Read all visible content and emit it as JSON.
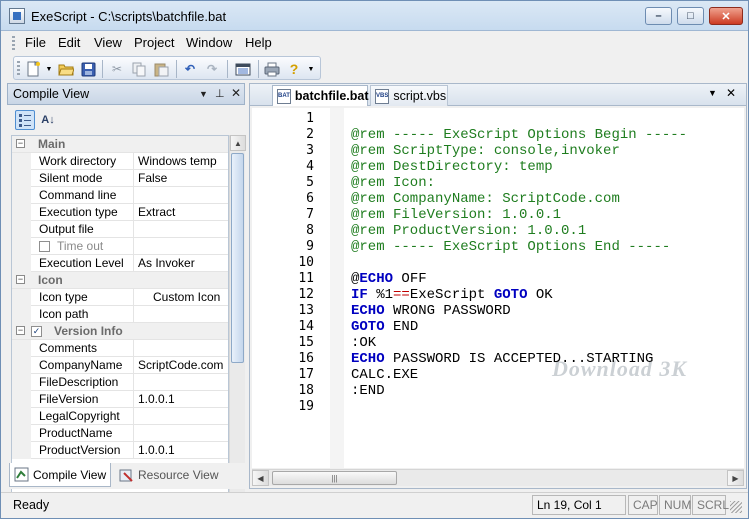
{
  "window": {
    "title": "ExeScript - C:\\scripts\\batchfile.bat",
    "minimize": "–",
    "maximize": "□",
    "close": "✕"
  },
  "menu": [
    "File",
    "Edit",
    "View",
    "Project",
    "Window",
    "Help"
  ],
  "toolbar": {
    "icons": [
      "new-file-icon",
      "open-folder-icon",
      "save-icon",
      "cut-icon",
      "copy-icon",
      "paste-icon",
      "undo-icon",
      "redo-icon",
      "compile-icon",
      "print-icon",
      "help-icon"
    ]
  },
  "left_panel": {
    "title": "Compile View",
    "rows": [
      {
        "type": "category",
        "label": "Main",
        "expanded": "⊟"
      },
      {
        "type": "prop",
        "key": "Work directory",
        "value": "Windows temp"
      },
      {
        "type": "prop",
        "key": "Silent mode",
        "value": "False"
      },
      {
        "type": "prop",
        "key": "Command line",
        "value": ""
      },
      {
        "type": "prop",
        "key": "Execution type",
        "value": "Extract"
      },
      {
        "type": "prop",
        "key": "Output file",
        "value": ""
      },
      {
        "type": "propcheck",
        "key": "Time out",
        "value": ""
      },
      {
        "type": "prop",
        "key": "Execution Level",
        "value": "As Invoker"
      },
      {
        "type": "category",
        "label": "Icon",
        "expanded": "⊟"
      },
      {
        "type": "prop",
        "key": "Icon type",
        "value": "Custom Icon"
      },
      {
        "type": "prop",
        "key": "Icon path",
        "value": ""
      },
      {
        "type": "categorycheck",
        "label": "Version Info",
        "expanded": "⊟"
      },
      {
        "type": "prop",
        "key": "Comments",
        "value": ""
      },
      {
        "type": "prop",
        "key": "CompanyName",
        "value": "ScriptCode.com"
      },
      {
        "type": "prop",
        "key": "FileDescription",
        "value": ""
      },
      {
        "type": "prop",
        "key": "FileVersion",
        "value": "1.0.0.1"
      },
      {
        "type": "prop",
        "key": "LegalCopyright",
        "value": ""
      },
      {
        "type": "prop",
        "key": "ProductName",
        "value": ""
      },
      {
        "type": "prop",
        "key": "ProductVersion",
        "value": "1.0.0.1"
      }
    ],
    "tabs": [
      "Compile View",
      "Resource View"
    ]
  },
  "editor": {
    "tabs": [
      {
        "label": "batchfile.bat",
        "badge": "BAT"
      },
      {
        "label": "script.vbs",
        "badge": "VBS"
      }
    ],
    "line_numbers": [
      "1",
      "2",
      "3",
      "4",
      "5",
      "6",
      "7",
      "8",
      "9",
      "10",
      "11",
      "12",
      "13",
      "14",
      "15",
      "16",
      "17",
      "18",
      "19"
    ],
    "lines": [
      [],
      [
        {
          "c": "cm",
          "t": "@rem ----- ExeScript Options Begin -----"
        }
      ],
      [
        {
          "c": "cm",
          "t": "@rem ScriptType: console,invoker"
        }
      ],
      [
        {
          "c": "cm",
          "t": "@rem DestDirectory: temp"
        }
      ],
      [
        {
          "c": "cm",
          "t": "@rem Icon:"
        }
      ],
      [
        {
          "c": "cm",
          "t": "@rem CompanyName: ScriptCode.com"
        }
      ],
      [
        {
          "c": "cm",
          "t": "@rem FileVersion: 1.0.0.1"
        }
      ],
      [
        {
          "c": "cm",
          "t": "@rem ProductVersion: 1.0.0.1"
        }
      ],
      [
        {
          "c": "cm",
          "t": "@rem ----- ExeScript Options End -----"
        }
      ],
      [],
      [
        {
          "c": "pl",
          "t": "@"
        },
        {
          "c": "kw",
          "t": "ECHO"
        },
        {
          "c": "pl",
          "t": " OFF"
        }
      ],
      [
        {
          "c": "kw",
          "t": "IF"
        },
        {
          "c": "pl",
          "t": " %1"
        },
        {
          "c": "op",
          "t": "=="
        },
        {
          "c": "pl",
          "t": "ExeScript "
        },
        {
          "c": "kw",
          "t": "GOTO"
        },
        {
          "c": "pl",
          "t": " OK"
        }
      ],
      [
        {
          "c": "kw",
          "t": "ECHO"
        },
        {
          "c": "pl",
          "t": " WRONG PASSWORD"
        }
      ],
      [
        {
          "c": "kw",
          "t": "GOTO"
        },
        {
          "c": "pl",
          "t": " END"
        }
      ],
      [
        {
          "c": "pl",
          "t": ":OK"
        }
      ],
      [
        {
          "c": "kw",
          "t": "ECHO"
        },
        {
          "c": "pl",
          "t": " PASSWORD IS ACCEPTED...STARTING"
        }
      ],
      [
        {
          "c": "pl",
          "t": "CALC.EXE"
        }
      ],
      [
        {
          "c": "pl",
          "t": ":END"
        }
      ],
      []
    ],
    "watermark": "Download 3K"
  },
  "status": {
    "ready": "Ready",
    "position": "Ln  19, Col  1",
    "caps": "CAP",
    "num": "NUM",
    "scrl": "SCRL"
  }
}
